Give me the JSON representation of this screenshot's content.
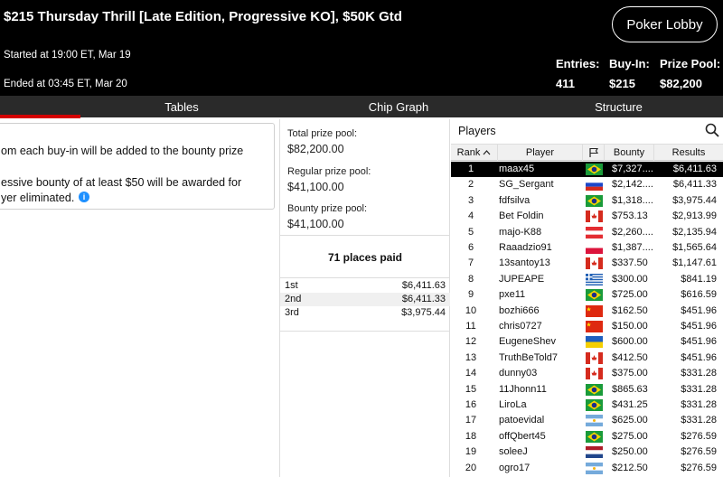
{
  "header": {
    "title": "$215 Thursday Thrill [Late Edition, Progressive KO], $50K Gtd",
    "started": "Started at 19:00 ET, Mar 19",
    "ended": "Ended at 03:45 ET, Mar 20",
    "lobby_button": "Poker Lobby",
    "stats": [
      {
        "label": "Entries:",
        "value": "411"
      },
      {
        "label": "Buy-In:",
        "value": "$215"
      },
      {
        "label": "Prize Pool:",
        "value": "$82,200"
      }
    ]
  },
  "tabs": [
    "Tables",
    "Chip Graph",
    "Structure"
  ],
  "info": {
    "line1": "om each buy-in will be added to the bounty prize",
    "line2": "essive bounty of at least $50 will be awarded for",
    "line3": "yer eliminated."
  },
  "prize": {
    "total_label": "Total prize pool:",
    "total_value": "$82,200.00",
    "regular_label": "Regular prize pool:",
    "regular_value": "$41,100.00",
    "bounty_label": "Bounty prize pool:",
    "bounty_value": "$41,100.00",
    "places_paid": "71 places paid",
    "payouts": [
      {
        "place": "1st",
        "amount": "$6,411.63"
      },
      {
        "place": "2nd",
        "amount": "$6,411.33"
      },
      {
        "place": "3rd",
        "amount": "$3,975.44"
      }
    ]
  },
  "players": {
    "title": "Players",
    "columns": {
      "rank": "Rank",
      "player": "Player",
      "bounty": "Bounty",
      "results": "Results"
    },
    "rows": [
      {
        "rank": "1",
        "name": "maax45",
        "flag": "br",
        "bounty": "$7,327....",
        "result": "$6,411.63"
      },
      {
        "rank": "2",
        "name": "SG_Sergant",
        "flag": "ru",
        "bounty": "$2,142....",
        "result": "$6,411.33"
      },
      {
        "rank": "3",
        "name": "fdfsilva",
        "flag": "br",
        "bounty": "$1,318....",
        "result": "$3,975.44"
      },
      {
        "rank": "4",
        "name": "Bet Foldin",
        "flag": "ca",
        "bounty": "$753.13",
        "result": "$2,913.99"
      },
      {
        "rank": "5",
        "name": "majo-K88",
        "flag": "at",
        "bounty": "$2,260....",
        "result": "$2,135.94"
      },
      {
        "rank": "6",
        "name": "Raaadzio91",
        "flag": "pl",
        "bounty": "$1,387....",
        "result": "$1,565.64"
      },
      {
        "rank": "7",
        "name": "13santoy13",
        "flag": "ca",
        "bounty": "$337.50",
        "result": "$1,147.61"
      },
      {
        "rank": "8",
        "name": "JUPEAPE",
        "flag": "gr",
        "bounty": "$300.00",
        "result": "$841.19"
      },
      {
        "rank": "9",
        "name": "pxe11",
        "flag": "br",
        "bounty": "$725.00",
        "result": "$616.59"
      },
      {
        "rank": "10",
        "name": "bozhi666",
        "flag": "cn",
        "bounty": "$162.50",
        "result": "$451.96"
      },
      {
        "rank": "11",
        "name": "chris0727",
        "flag": "cn",
        "bounty": "$150.00",
        "result": "$451.96"
      },
      {
        "rank": "12",
        "name": "EugeneShev",
        "flag": "ua",
        "bounty": "$600.00",
        "result": "$451.96"
      },
      {
        "rank": "13",
        "name": "TruthBeTold7",
        "flag": "ca",
        "bounty": "$412.50",
        "result": "$451.96"
      },
      {
        "rank": "14",
        "name": "dunny03",
        "flag": "ca",
        "bounty": "$375.00",
        "result": "$331.28"
      },
      {
        "rank": "15",
        "name": "11Jhonn11",
        "flag": "br",
        "bounty": "$865.63",
        "result": "$331.28"
      },
      {
        "rank": "16",
        "name": "LiroLa",
        "flag": "br",
        "bounty": "$431.25",
        "result": "$331.28"
      },
      {
        "rank": "17",
        "name": "patoevidal",
        "flag": "ar",
        "bounty": "$625.00",
        "result": "$331.28"
      },
      {
        "rank": "18",
        "name": "offQbert45",
        "flag": "br",
        "bounty": "$275.00",
        "result": "$276.59"
      },
      {
        "rank": "19",
        "name": "soleeJ",
        "flag": "nl",
        "bounty": "$250.00",
        "result": "$276.59"
      },
      {
        "rank": "20",
        "name": "ogro17",
        "flag": "ar",
        "bounty": "$212.50",
        "result": "$276.59"
      }
    ]
  },
  "colors": {
    "header_bg": "#000000",
    "tab_bar": "#2a2a2a",
    "tab_active": "#d40000",
    "info_icon": "#1e90ff",
    "selected_row": "#000000"
  }
}
